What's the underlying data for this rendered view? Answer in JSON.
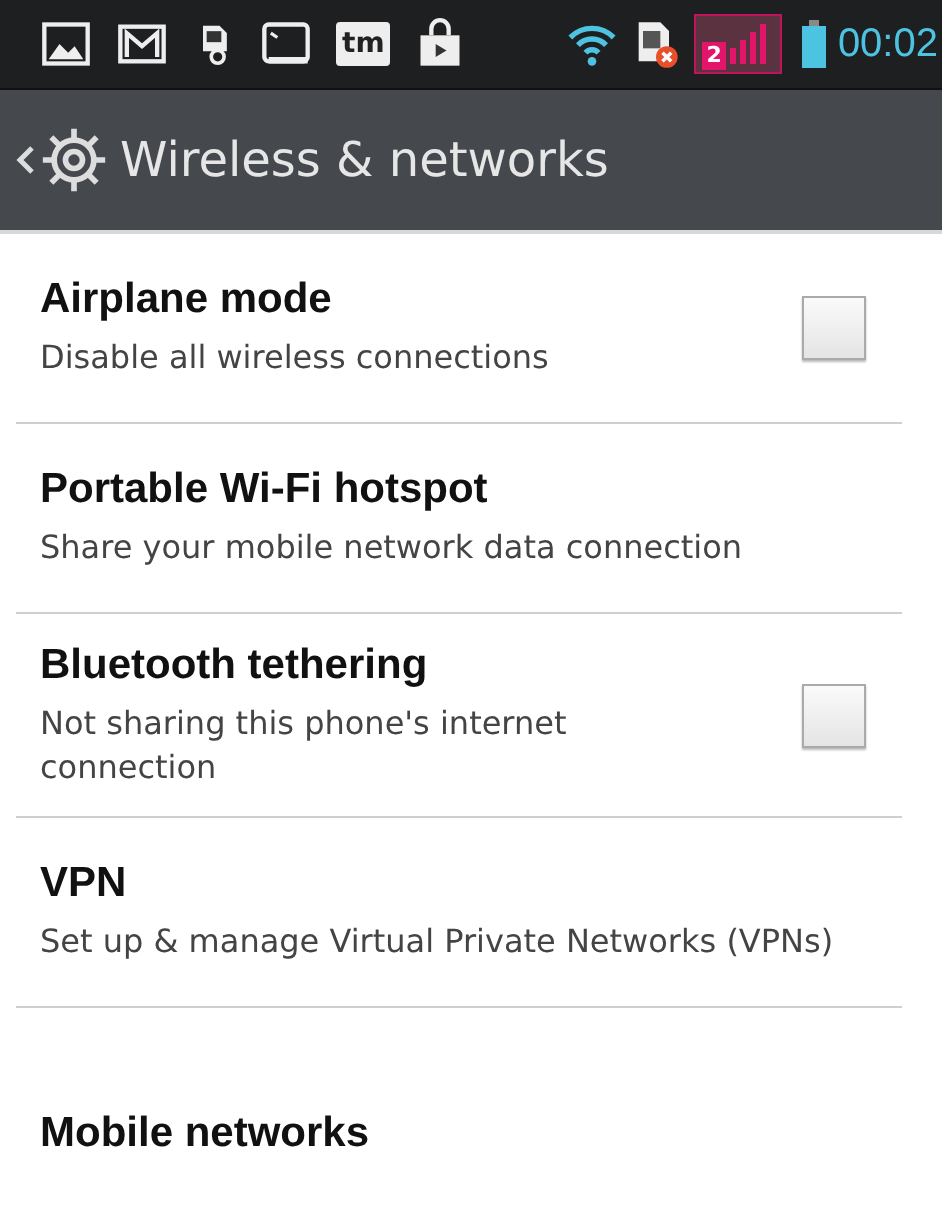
{
  "status_bar": {
    "tm_label": "tm",
    "sim_badge": "2",
    "time": "00:02"
  },
  "action_bar": {
    "title": "Wireless & networks"
  },
  "items": [
    {
      "kind": "checkbox",
      "title": "Airplane mode",
      "summary": "Disable all wireless connections",
      "checked": false
    },
    {
      "kind": "plain",
      "title": "Portable Wi-Fi hotspot",
      "summary": "Share your mobile network data connection"
    },
    {
      "kind": "checkbox",
      "title": "Bluetooth tethering",
      "summary": "Not sharing this phone's internet connection",
      "checked": false
    },
    {
      "kind": "plain",
      "title": "VPN",
      "summary": "Set up & manage Virtual Private Networks (VPNs)"
    },
    {
      "kind": "plain",
      "title": "Mobile networks"
    }
  ]
}
